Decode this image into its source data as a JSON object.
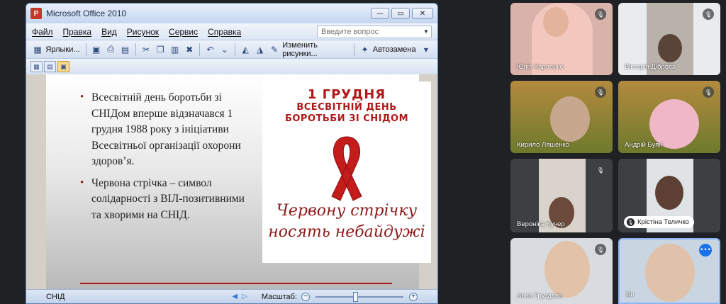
{
  "window": {
    "title": "Microsoft Office 2010",
    "app_icon_letter": "P",
    "controls": {
      "minimize": "—",
      "maximize": "▭",
      "close": "✕"
    }
  },
  "menu": {
    "items": [
      "Файл",
      "Правка",
      "Вид",
      "Рисунок",
      "Сервис",
      "Справка"
    ],
    "help_placeholder": "Введите вопрос"
  },
  "toolbar": {
    "shortcuts_label": "Ярлыки...",
    "change_picture_label": "Изменить рисунки...",
    "autoreplace_label": "Автозамена"
  },
  "slide": {
    "bullets": [
      "Всесвітній день боротьби зі СНІДом вперше відзначався 1 грудня 1988 року з ініціативи Всесвітньої організації охорони здоров’я.",
      "Червона стрічка – символ солідарності з ВІЛ-позитивними та хворими на СНІД."
    ],
    "poster_title_line1": "1 ГРУДНЯ",
    "poster_title_line2": "ВСЕСВІТНІЙ ДЕНЬ",
    "poster_title_line3": "БОРОТЬБИ ЗІ СНІДОМ",
    "poster_script_line1": "Червону стрічку",
    "poster_script_line2": "носять небайдужі"
  },
  "statusbar": {
    "album_name": "СНІД",
    "zoom_label": "Масштаб:",
    "zoom_level": 0.45
  },
  "participants": [
    {
      "name": "Юлія Карпенко",
      "muted": true
    },
    {
      "name": "Вікторія Діброва",
      "muted": true
    },
    {
      "name": "Кирило Ляшенко",
      "muted": true
    },
    {
      "name": "Андрій Буян",
      "muted": true
    },
    {
      "name": "Вероніка Кучер",
      "muted": true
    },
    {
      "name": "Крістіна Теличко",
      "muted": true
    },
    {
      "name": "Анна Груздєва",
      "muted": true
    },
    {
      "name": "Ви",
      "speaking": true
    }
  ],
  "colors": {
    "accent_red": "#b01818",
    "meet_blue": "#1a73e8",
    "background": "#202124"
  }
}
